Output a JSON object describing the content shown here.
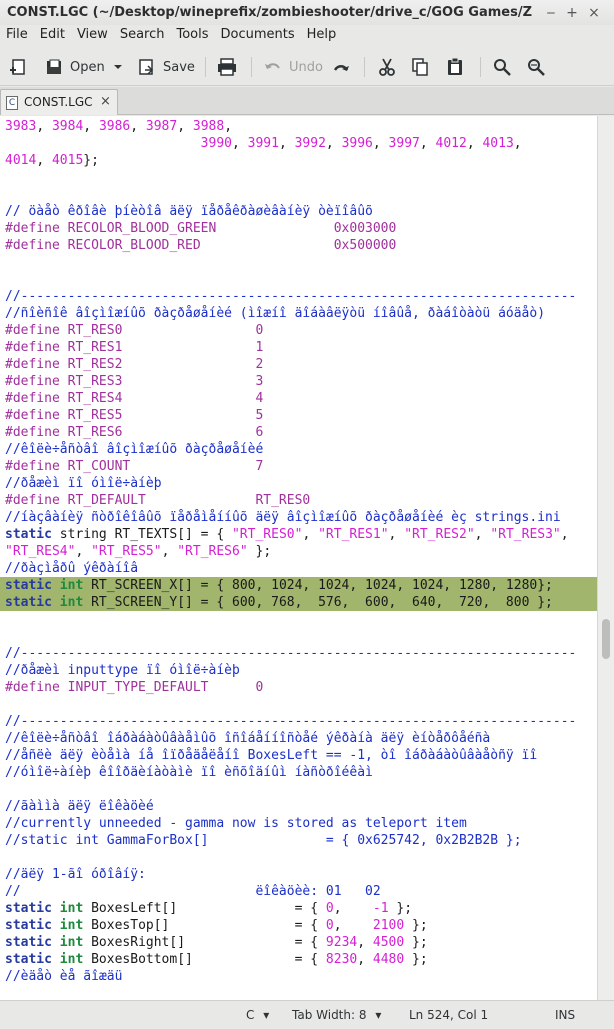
{
  "window": {
    "title": "CONST.LGC (~/Desktop/wineprefix/zombieshooter/drive_c/GOG Games/Zombie Shooter/LOGIC) - gedit",
    "minimize_glyph": "‒",
    "maximize_glyph": "+",
    "close_glyph": "×"
  },
  "menu": {
    "items": [
      "File",
      "Edit",
      "View",
      "Search",
      "Tools",
      "Documents",
      "Help"
    ]
  },
  "toolbar": {
    "open_label": "Open",
    "save_label": "Save",
    "undo_label": "Undo"
  },
  "tab": {
    "name": "CONST.LGC",
    "icon_letter": "C",
    "close_glyph": "×"
  },
  "code": {
    "highlight_color": "#a1b56c",
    "highlighted_lines": [
      27,
      28
    ],
    "lines": [
      [
        [
          "num",
          "3983"
        ],
        [
          "default",
          ", "
        ],
        [
          "num",
          "3984"
        ],
        [
          "default",
          ", "
        ],
        [
          "num",
          "3986"
        ],
        [
          "default",
          ", "
        ],
        [
          "num",
          "3987"
        ],
        [
          "default",
          ", "
        ],
        [
          "num",
          "3988"
        ],
        [
          "default",
          ","
        ]
      ],
      [
        [
          "default",
          "                         "
        ],
        [
          "num",
          "3990"
        ],
        [
          "default",
          ", "
        ],
        [
          "num",
          "3991"
        ],
        [
          "default",
          ", "
        ],
        [
          "num",
          "3992"
        ],
        [
          "default",
          ", "
        ],
        [
          "num",
          "3996"
        ],
        [
          "default",
          ", "
        ],
        [
          "num",
          "3997"
        ],
        [
          "default",
          ", "
        ],
        [
          "num",
          "4012"
        ],
        [
          "default",
          ", "
        ],
        [
          "num",
          "4013"
        ],
        [
          "default",
          ","
        ]
      ],
      [
        [
          "num",
          "4014"
        ],
        [
          "default",
          ", "
        ],
        [
          "num",
          "4015"
        ],
        [
          "default",
          "};"
        ]
      ],
      [],
      [],
      [
        [
          "cmt",
          "// öàåò êðîâè þíèòîâ äëÿ ïåðåêðàøèâàíèÿ òèïîâûõ"
        ]
      ],
      [
        [
          "pre",
          "#define RECOLOR_BLOOD_GREEN               0x003000"
        ]
      ],
      [
        [
          "pre",
          "#define RECOLOR_BLOOD_RED                 0x500000"
        ]
      ],
      [],
      [],
      [
        [
          "cmt",
          "//-----------------------------------------------------------------------"
        ]
      ],
      [
        [
          "cmt",
          "//ñîèñîê âîçìîæíûõ ðàçðåøåíèé (ìîæíî äîáàâëÿòü íîâûå, ðàáîòàòü áóäåò)"
        ]
      ],
      [
        [
          "pre",
          "#define RT_RES0                 0"
        ]
      ],
      [
        [
          "pre",
          "#define RT_RES1                 1"
        ]
      ],
      [
        [
          "pre",
          "#define RT_RES2                 2"
        ]
      ],
      [
        [
          "pre",
          "#define RT_RES3                 3"
        ]
      ],
      [
        [
          "pre",
          "#define RT_RES4                 4"
        ]
      ],
      [
        [
          "pre",
          "#define RT_RES5                 5"
        ]
      ],
      [
        [
          "pre",
          "#define RT_RES6                 6"
        ]
      ],
      [
        [
          "cmt",
          "//êîëè÷åñòâî âîçìîæíûõ ðàçðåøåíèé"
        ]
      ],
      [
        [
          "pre",
          "#define RT_COUNT                7"
        ]
      ],
      [
        [
          "cmt",
          "//ðåæèì ïî óìîë÷àíèþ"
        ]
      ],
      [
        [
          "pre",
          "#define RT_DEFAULT              RT_RES0"
        ]
      ],
      [
        [
          "cmt",
          "//íàçâàíèÿ ñòðîêîâûõ ïåðåìåííûõ äëÿ âîçìîæíûõ ðàçðåøåíèé èç strings.ini"
        ]
      ],
      [
        [
          "kw",
          "static"
        ],
        [
          "default",
          " string RT_TEXTS[] = { "
        ],
        [
          "str",
          "\"RT_RES0\""
        ],
        [
          "default",
          ", "
        ],
        [
          "str",
          "\"RT_RES1\""
        ],
        [
          "default",
          ", "
        ],
        [
          "str",
          "\"RT_RES2\""
        ],
        [
          "default",
          ", "
        ],
        [
          "str",
          "\"RT_RES3\""
        ],
        [
          "default",
          ","
        ]
      ],
      [
        [
          "str",
          "\"RT_RES4\""
        ],
        [
          "default",
          ", "
        ],
        [
          "str",
          "\"RT_RES5\""
        ],
        [
          "default",
          ", "
        ],
        [
          "str",
          "\"RT_RES6\""
        ],
        [
          "default",
          " };"
        ]
      ],
      [
        [
          "cmt",
          "//ðàçìåðû ýêðàíîâ"
        ]
      ],
      [
        [
          "kw",
          "static"
        ],
        [
          "default",
          " "
        ],
        [
          "type",
          "int"
        ],
        [
          "default",
          " RT_SCREEN_X[] = { 800, 1024, 1024, 1024, 1024, 1280, 1280};"
        ]
      ],
      [
        [
          "kw",
          "static"
        ],
        [
          "default",
          " "
        ],
        [
          "type",
          "int"
        ],
        [
          "default",
          " RT_SCREEN_Y[] = { 600, 768,  576,  600,  640,  720,  800 };"
        ]
      ],
      [],
      [],
      [
        [
          "cmt",
          "//-----------------------------------------------------------------------"
        ]
      ],
      [
        [
          "cmt",
          "//ðåæèì inputtype ïî óìîë÷àíèþ"
        ]
      ],
      [
        [
          "pre",
          "#define INPUT_TYPE_DEFAULT      0"
        ]
      ],
      [],
      [
        [
          "cmt",
          "//-----------------------------------------------------------------------"
        ]
      ],
      [
        [
          "cmt",
          "//êîëè÷åñòâî îáðàáàòûâàåìûõ îñîáåííîñòåé ýêðàíà äëÿ èíòåðôåéñà"
        ]
      ],
      [
        [
          "cmt",
          "//åñëè äëÿ èòåìà íå îïðåäåëåíî BoxesLeft == -1, òî îáðàáàòûâàåòñÿ ïî"
        ]
      ],
      [
        [
          "cmt",
          "//óìîë÷àíèþ êîîðäèíàòàìè ïî èñõîäíûì íàñòðîéêàì"
        ]
      ],
      [],
      [
        [
          "cmt",
          "//ãàììà äëÿ ëîêàöèé"
        ]
      ],
      [
        [
          "cmt",
          "//currently unneeded - gamma now is stored as teleport item"
        ]
      ],
      [
        [
          "cmt",
          "//static int GammaForBox[]               = { 0x625742, 0x2B2B2B };"
        ]
      ],
      [],
      [
        [
          "cmt",
          "//äëÿ 1-ãî óðîâíÿ:"
        ]
      ],
      [
        [
          "cmt",
          "//                              ëîêàöèè: 01   02"
        ]
      ],
      [
        [
          "kw",
          "static"
        ],
        [
          "default",
          " "
        ],
        [
          "type",
          "int"
        ],
        [
          "default",
          " BoxesLeft[]               = { "
        ],
        [
          "num",
          "0"
        ],
        [
          "default",
          ",    "
        ],
        [
          "num",
          "-1"
        ],
        [
          "default",
          " };"
        ]
      ],
      [
        [
          "kw",
          "static"
        ],
        [
          "default",
          " "
        ],
        [
          "type",
          "int"
        ],
        [
          "default",
          " BoxesTop[]                = { "
        ],
        [
          "num",
          "0"
        ],
        [
          "default",
          ",    "
        ],
        [
          "num",
          "2100"
        ],
        [
          "default",
          " };"
        ]
      ],
      [
        [
          "kw",
          "static"
        ],
        [
          "default",
          " "
        ],
        [
          "type",
          "int"
        ],
        [
          "default",
          " BoxesRight[]              = { "
        ],
        [
          "num",
          "9234"
        ],
        [
          "default",
          ", "
        ],
        [
          "num",
          "4500"
        ],
        [
          "default",
          " };"
        ]
      ],
      [
        [
          "kw",
          "static"
        ],
        [
          "default",
          " "
        ],
        [
          "type",
          "int"
        ],
        [
          "default",
          " BoxesBottom[]             = { "
        ],
        [
          "num",
          "8230"
        ],
        [
          "default",
          ", "
        ],
        [
          "num",
          "4480"
        ],
        [
          "default",
          " };"
        ]
      ],
      [
        [
          "cmt",
          "//èäåò èå ãîæäü"
        ]
      ]
    ]
  },
  "status": {
    "language": "C",
    "tab_width": "Tab Width: 8",
    "position": "Ln 524, Col 1",
    "mode": "INS"
  }
}
